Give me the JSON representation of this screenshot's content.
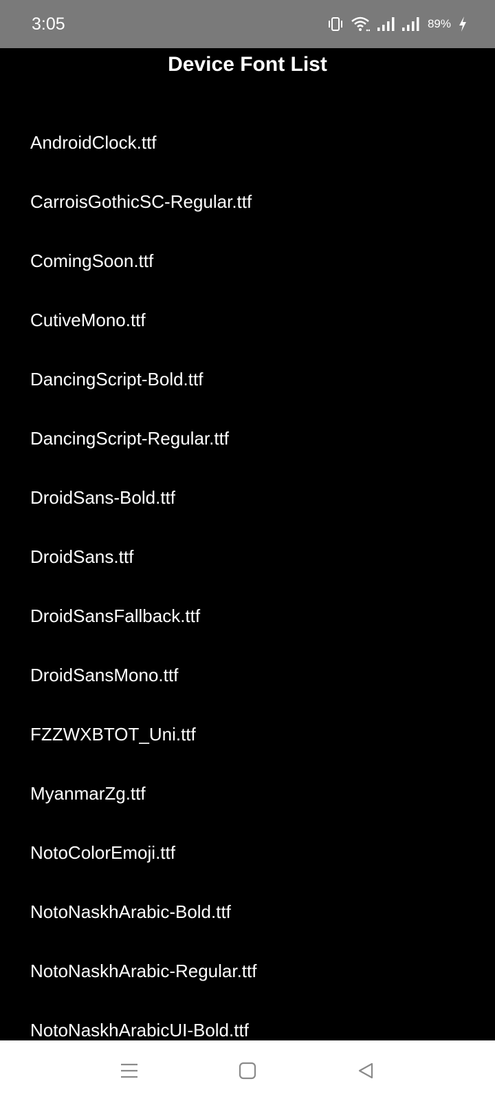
{
  "status_bar": {
    "time": "3:05",
    "battery_percent": "89%",
    "icons": [
      "vibrate-icon",
      "wifi-icon",
      "signal-icon",
      "signal-icon",
      "charging-icon"
    ]
  },
  "page": {
    "title": "Device Font List"
  },
  "fonts": [
    "AndroidClock.ttf",
    "CarroisGothicSC-Regular.ttf",
    "ComingSoon.ttf",
    "CutiveMono.ttf",
    "DancingScript-Bold.ttf",
    "DancingScript-Regular.ttf",
    "DroidSans-Bold.ttf",
    "DroidSans.ttf",
    "DroidSansFallback.ttf",
    "DroidSansMono.ttf",
    "FZZWXBTOT_Uni.ttf",
    "MyanmarZg.ttf",
    "NotoColorEmoji.ttf",
    "NotoNaskhArabic-Bold.ttf",
    "NotoNaskhArabic-Regular.ttf",
    "NotoNaskhArabicUI-Bold.ttf"
  ],
  "nav_bar": {
    "buttons": [
      "menu-icon",
      "home-icon",
      "back-icon"
    ]
  },
  "colors": {
    "status_bar_bg": "#7a7a7a",
    "app_bg": "#000000",
    "text": "#ffffff",
    "nav_bar_bg": "#ffffff",
    "nav_icon": "#8a8a8a"
  }
}
